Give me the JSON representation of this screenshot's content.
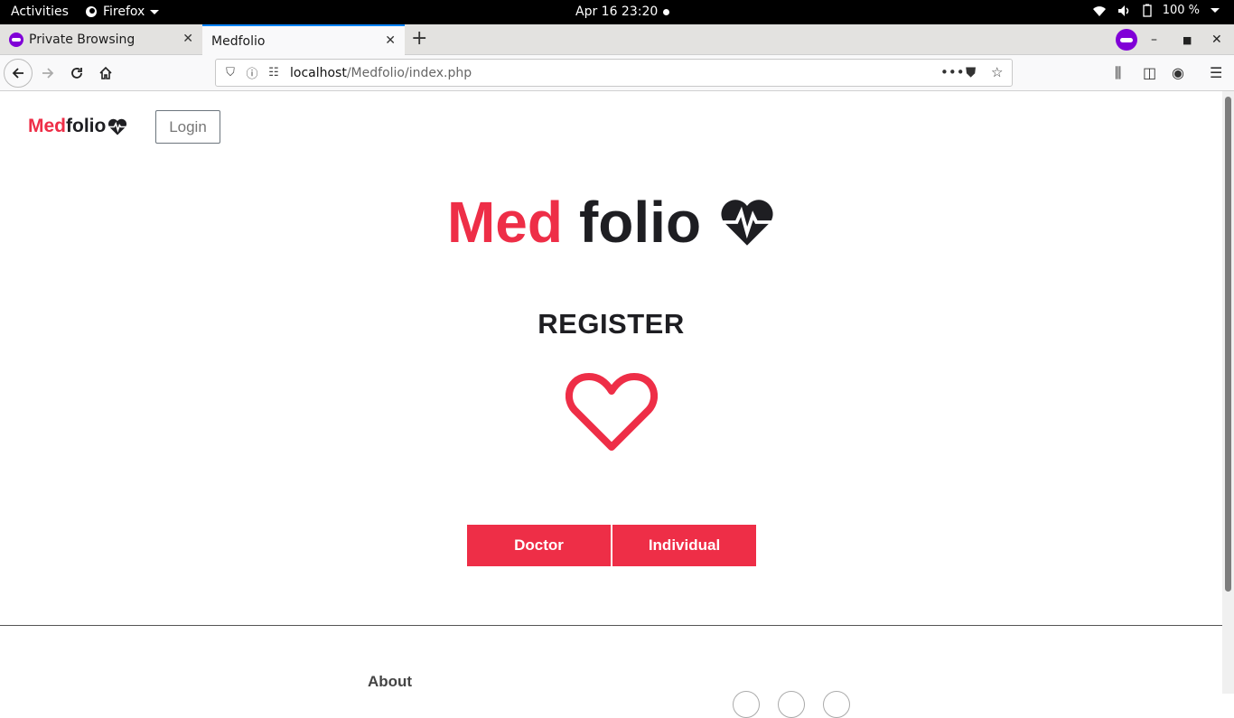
{
  "topbar": {
    "activities": "Activities",
    "app_name": "Firefox",
    "clock": "Apr 16  23:20",
    "battery": "100 %"
  },
  "tabs": [
    {
      "label": "Private Browsing",
      "active": false
    },
    {
      "label": "Medfolio",
      "active": true
    }
  ],
  "navbar": {
    "url_host": "localhost",
    "url_path": "/Medfolio/index.php"
  },
  "page": {
    "brand": {
      "part1": "Med",
      "part2": "folio"
    },
    "login_label": "Login",
    "hero": {
      "part1": "Med",
      "part2": "folio"
    },
    "register_heading": "REGISTER",
    "buttons": {
      "doctor": "Doctor",
      "individual": "Individual"
    },
    "footer": {
      "about": "About"
    }
  },
  "colors": {
    "accent": "#ee2e47",
    "dark": "#1e1e22",
    "private_purple": "#8000d7"
  }
}
